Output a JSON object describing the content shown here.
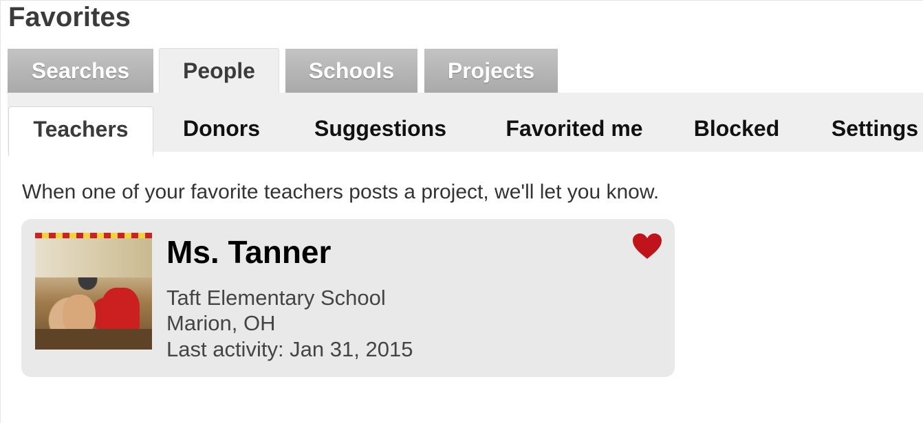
{
  "page": {
    "title": "Favorites"
  },
  "tabs": [
    {
      "label": "Searches",
      "active": false
    },
    {
      "label": "People",
      "active": true
    },
    {
      "label": "Schools",
      "active": false
    },
    {
      "label": "Projects",
      "active": false
    }
  ],
  "subtabs": [
    {
      "label": "Teachers",
      "active": true
    },
    {
      "label": "Donors",
      "active": false
    },
    {
      "label": "Suggestions",
      "active": false
    },
    {
      "label": "Favorited me",
      "active": false
    },
    {
      "label": "Blocked",
      "active": false
    },
    {
      "label": "Settings",
      "active": false
    }
  ],
  "intro_text": "When one of your favorite teachers posts a project, we'll let you know.",
  "favorites": [
    {
      "name": "Ms. Tanner",
      "school": "Taft Elementary School",
      "location": "Marion, OH",
      "last_activity": "Last activity: Jan 31, 2015",
      "favorited_icon": "heart-icon",
      "heart_color": "#c0141c"
    }
  ],
  "colors": {
    "tab_inactive": "#b3b3b3",
    "tab_active_bg": "#efefef",
    "card_bg": "#e9e9e9"
  }
}
